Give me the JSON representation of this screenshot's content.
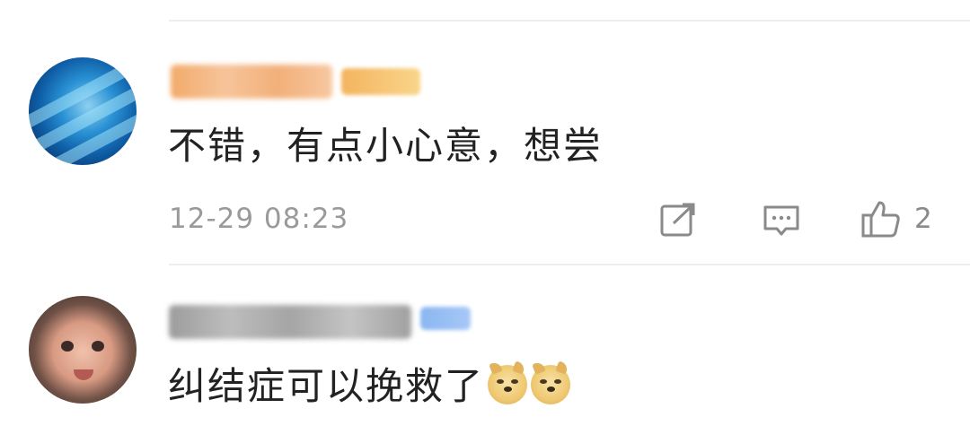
{
  "comments": [
    {
      "username": "",
      "username_blurred": true,
      "badge_blurred": true,
      "avatar": "globe-avatar",
      "text": "不错，有点小心意，想尝",
      "timestamp": "12-29 08:23",
      "actions": {
        "share_icon": "share-icon",
        "reply_icon": "reply-icon",
        "like_icon": "like-icon",
        "like_count": "2"
      }
    },
    {
      "username": "",
      "username_blurred": true,
      "badge_blurred": true,
      "avatar": "child-avatar",
      "text": "纠结症可以挽救了",
      "emojis": [
        "doge-emoji",
        "doge-emoji"
      ]
    }
  ],
  "colors": {
    "username_1": "#f3b274",
    "badge_1": "#f7c96b",
    "username_2": "#a8a8a8",
    "badge_2": "#8db8f2",
    "text": "#222222",
    "meta": "#9a9a9a"
  }
}
